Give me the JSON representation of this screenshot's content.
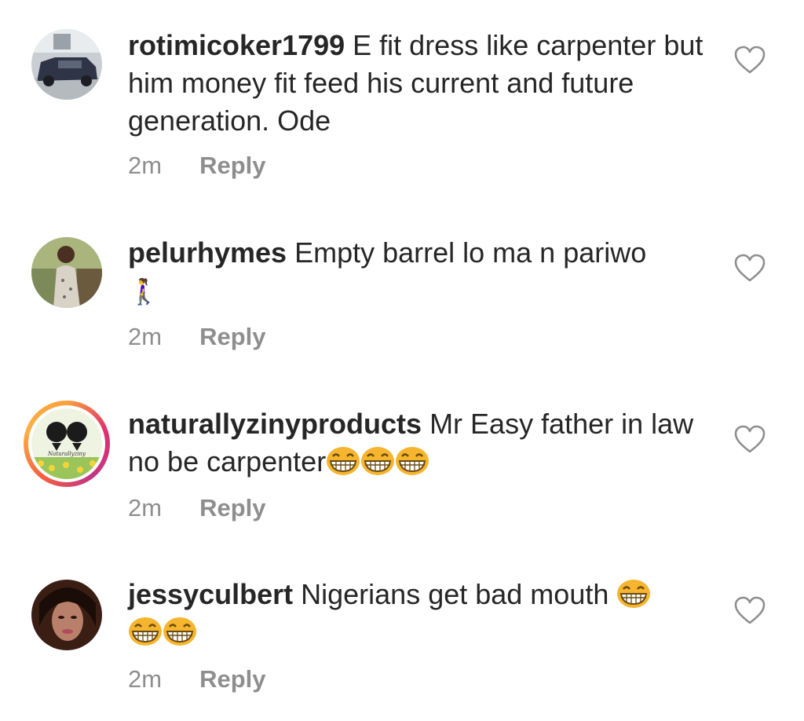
{
  "comments": [
    {
      "username": "rotimicoker1799",
      "text": " E fit dress like carpenter but him money fit feed his current and future generation. Ode",
      "time": "2m",
      "reply_label": "Reply",
      "avatar_icon": "car-photo-avatar"
    },
    {
      "username": "pelurhymes",
      "text": " Empty barrel lo ma n pariwo",
      "emoji_line": "🚶‍♀",
      "time": "2m",
      "reply_label": "Reply",
      "avatar_icon": "person-photo-avatar"
    },
    {
      "username": "naturallyzinyproducts",
      "text": " Mr Easy father in law no be carpenter",
      "emoji_count": 3,
      "time": "2m",
      "reply_label": "Reply",
      "avatar_icon": "afro-logo-avatar-with-story-ring",
      "avatar_logo_text": "Naturallyziny"
    },
    {
      "username": "jessyculbert",
      "text": " Nigerians get bad mouth ",
      "emoji_count": 3,
      "time": "2m",
      "reply_label": "Reply",
      "avatar_icon": "woman-photo-avatar"
    }
  ],
  "like_icon": "heart-outline-icon",
  "colors": {
    "text": "#262626",
    "meta": "#8e8e8e",
    "emoji": "#f5b52e",
    "story_ring": "#e1306c"
  }
}
